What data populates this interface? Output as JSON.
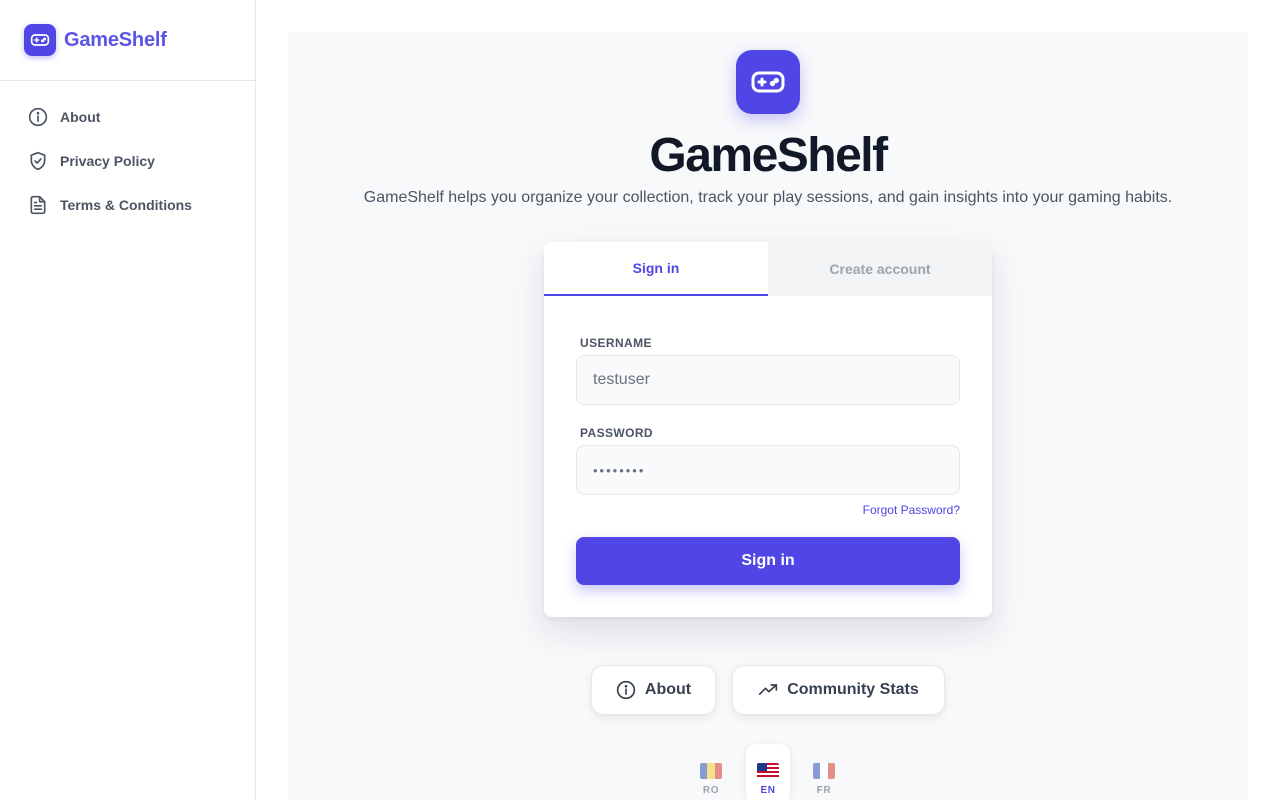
{
  "app": {
    "name": "GameShelf",
    "accent": "#4f46e5"
  },
  "sidebar": {
    "items": [
      {
        "label": "About",
        "icon": "info-icon"
      },
      {
        "label": "Privacy Policy",
        "icon": "shield-check-icon"
      },
      {
        "label": "Terms & Conditions",
        "icon": "document-icon"
      }
    ]
  },
  "hero": {
    "title": "GameShelf",
    "subtitle": "GameShelf helps you organize your collection, track your play sessions, and gain insights into your gaming habits."
  },
  "auth": {
    "tabs": [
      {
        "label": "Sign in",
        "active": true
      },
      {
        "label": "Create account",
        "active": false
      }
    ],
    "username": {
      "label": "USERNAME",
      "value": "testuser"
    },
    "password": {
      "label": "PASSWORD",
      "value": "••••••••"
    },
    "forgot_label": "Forgot Password?",
    "submit_label": "Sign in"
  },
  "links": {
    "about_label": "About",
    "stats_label": "Community Stats"
  },
  "languages": [
    {
      "code": "RO",
      "flag": "romania-flag-icon",
      "active": false
    },
    {
      "code": "EN",
      "flag": "us-flag-icon",
      "active": true
    },
    {
      "code": "FR",
      "flag": "france-flag-icon",
      "active": false
    }
  ]
}
